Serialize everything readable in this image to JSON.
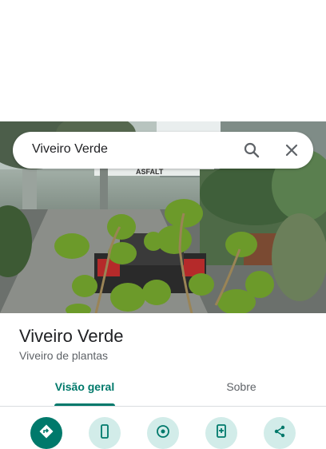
{
  "search": {
    "query": "Viveiro Verde"
  },
  "place": {
    "name": "Viveiro Verde",
    "category": "Viveiro de plantas"
  },
  "tabs": [
    {
      "label": "Visão geral",
      "selected": true
    },
    {
      "label": "Sobre",
      "selected": false
    }
  ],
  "hero": {
    "sign_text": "ASFALT"
  },
  "actions": [
    {
      "icon": "directions-icon"
    },
    {
      "icon": "phone-icon"
    },
    {
      "icon": "location-icon"
    },
    {
      "icon": "add-photo-icon"
    },
    {
      "icon": "share-icon"
    }
  ],
  "colors": {
    "accent": "#00796b",
    "action_bg": "#d2ece9"
  }
}
